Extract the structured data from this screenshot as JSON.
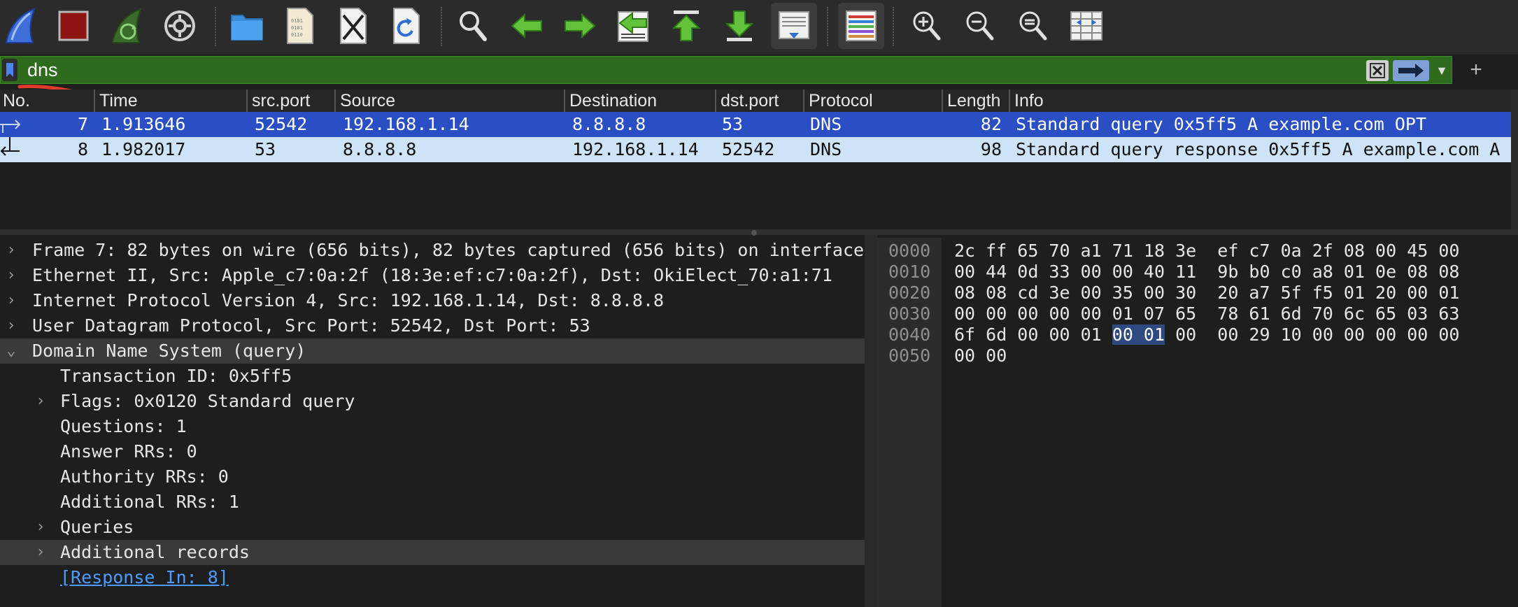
{
  "toolbar": {
    "buttons": [
      {
        "name": "start-capture-icon"
      },
      {
        "name": "stop-capture-icon"
      },
      {
        "name": "restart-capture-icon"
      },
      {
        "name": "capture-options-icon"
      },
      {
        "name": "open-file-icon"
      },
      {
        "name": "save-file-icon"
      },
      {
        "name": "close-file-icon"
      },
      {
        "name": "reload-file-icon"
      },
      {
        "name": "find-packet-icon"
      },
      {
        "name": "go-back-icon"
      },
      {
        "name": "go-forward-icon"
      },
      {
        "name": "go-to-packet-icon"
      },
      {
        "name": "go-first-packet-icon"
      },
      {
        "name": "go-last-packet-icon"
      },
      {
        "name": "auto-scroll-icon"
      },
      {
        "name": "colorize-icon"
      },
      {
        "name": "zoom-in-icon"
      },
      {
        "name": "zoom-out-icon"
      },
      {
        "name": "zoom-normal-icon"
      },
      {
        "name": "resize-columns-icon"
      }
    ]
  },
  "filter": {
    "value": "dns",
    "bar_color": "#2e6b1c"
  },
  "packet_list": {
    "columns": [
      "No.",
      "Time",
      "src.port",
      "Source",
      "Destination",
      "dst.port",
      "Protocol",
      "Length",
      "Info"
    ],
    "rows": [
      {
        "no": "7",
        "time": "1.913646",
        "src_port": "52542",
        "source": "192.168.1.14",
        "destination": "8.8.8.8",
        "dst_port": "53",
        "protocol": "DNS",
        "length": "82",
        "info": "Standard query 0x5ff5 A example.com OPT",
        "selected": true
      },
      {
        "no": "8",
        "time": "1.982017",
        "src_port": "53",
        "source": "8.8.8.8",
        "destination": "192.168.1.14",
        "dst_port": "52542",
        "protocol": "DNS",
        "length": "98",
        "info": "Standard query response 0x5ff5 A example.com A",
        "selected": false
      }
    ],
    "selected_color": "#2a4ec3",
    "related_color": "#cfe3f7"
  },
  "details": {
    "rows": [
      {
        "expander": "›",
        "text": "Frame 7: 82 bytes on wire (656 bits), 82 bytes captured (656 bits) on interface"
      },
      {
        "expander": "›",
        "text": "Ethernet II, Src: Apple_c7:0a:2f (18:3e:ef:c7:0a:2f), Dst: OkiElect_70:a1:71"
      },
      {
        "expander": "›",
        "text": "Internet Protocol Version 4, Src: 192.168.1.14, Dst: 8.8.8.8"
      },
      {
        "expander": "›",
        "text": "User Datagram Protocol, Src Port: 52542, Dst Port: 53"
      },
      {
        "expander": "⌄",
        "text": "Domain Name System (query)"
      },
      {
        "expander": "",
        "text": "Transaction ID: 0x5ff5"
      },
      {
        "expander": "›",
        "text": "Flags: 0x0120 Standard query"
      },
      {
        "expander": "",
        "text": "Questions: 1"
      },
      {
        "expander": "",
        "text": "Answer RRs: 0"
      },
      {
        "expander": "",
        "text": "Authority RRs: 0"
      },
      {
        "expander": "",
        "text": "Additional RRs: 1"
      },
      {
        "expander": "›",
        "text": "Queries"
      },
      {
        "expander": "›",
        "text": "Additional records"
      },
      {
        "expander": "",
        "text": "[Response In: 8]"
      }
    ]
  },
  "bytes": {
    "offsets": [
      "0000",
      "0010",
      "0020",
      "0030",
      "0040",
      "0050"
    ],
    "lines": [
      "2c ff 65 70 a1 71 18 3e  ef c7 0a 2f 08 00 45 00",
      "00 44 0d 33 00 00 40 11  9b b0 c0 a8 01 0e 08 08",
      "08 08 cd 3e 00 35 00 30  20 a7 5f f5 01 20 00 01",
      "00 00 00 00 00 01 07 65  78 61 6d 70 6c 65 03 63",
      {
        "before": "6f 6d 00 00 01 ",
        "selected": "00 01",
        "after": " 00  00 29 10 00 00 00 00 00"
      },
      "00 00"
    ]
  }
}
